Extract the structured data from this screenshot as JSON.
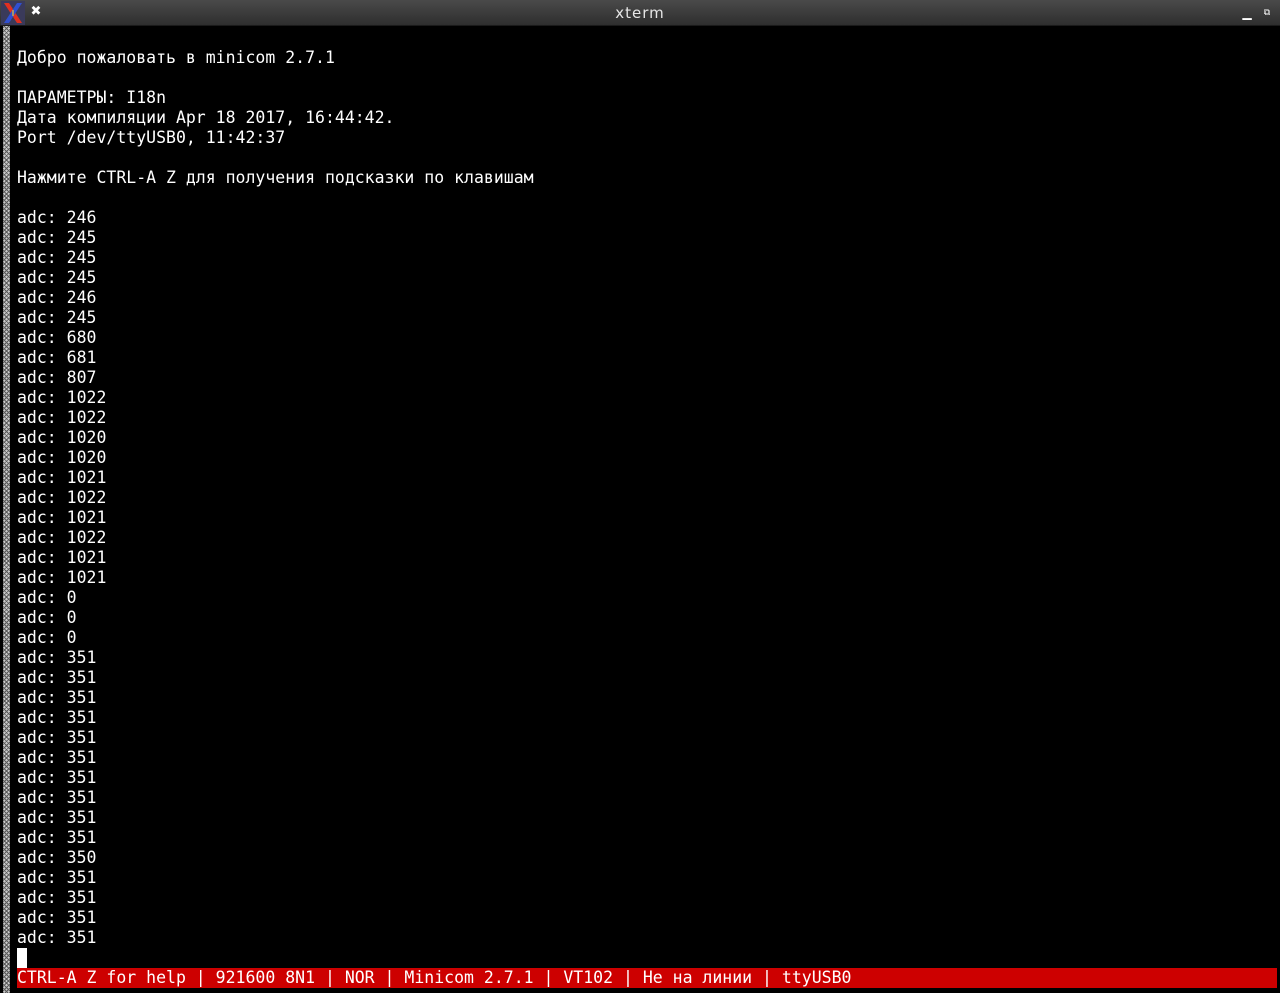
{
  "window": {
    "title": "xterm",
    "logo_icon": "x-window-system-logo",
    "close_glyph": "✖",
    "minimize_glyph": "▁",
    "maximize_glyph": "⧉"
  },
  "terminal": {
    "lines": [
      "Добро пожаловать в minicom 2.7.1",
      "",
      "ПАРАМЕТРЫ: I18n",
      "Дата компиляции Apr 18 2017, 16:44:42.",
      "Port /dev/ttyUSB0, 11:42:37",
      "",
      "Нажмите CTRL-A Z для получения подсказки по клавишам",
      "",
      "adc: 246",
      "adc: 245",
      "adc: 245",
      "adc: 245",
      "adc: 246",
      "adc: 245",
      "adc: 680",
      "adc: 681",
      "adc: 807",
      "adc: 1022",
      "adc: 1022",
      "adc: 1020",
      "adc: 1020",
      "adc: 1021",
      "adc: 1022",
      "adc: 1021",
      "adc: 1022",
      "adc: 1021",
      "adc: 1021",
      "adc: 0",
      "adc: 0",
      "adc: 0",
      "adc: 351",
      "adc: 351",
      "adc: 351",
      "adc: 351",
      "adc: 351",
      "adc: 351",
      "adc: 351",
      "adc: 351",
      "adc: 351",
      "adc: 351",
      "adc: 350",
      "adc: 351",
      "adc: 351",
      "adc: 351",
      "adc: 351"
    ]
  },
  "statusbar": {
    "text": "CTRL-A Z for help | 921600 8N1 | NOR | Minicom 2.7.1 | VT102 | Не на линии | ttyUSB0"
  },
  "colors": {
    "background": "#000000",
    "text": "#ffffff",
    "statusbar_bg": "#cd0000",
    "titlebar_bg": "#3a3a3a"
  }
}
